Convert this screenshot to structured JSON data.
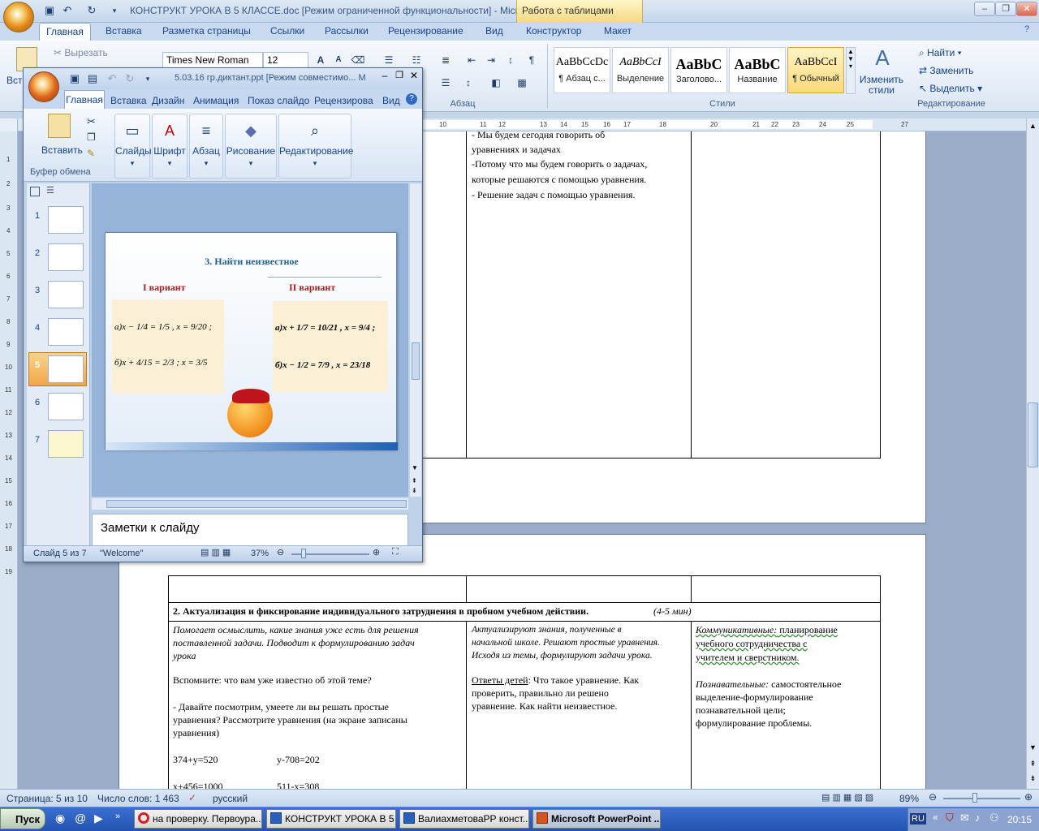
{
  "word": {
    "title": "КОНСТРУКТ УРОКА В 5 КЛАССЕ.doc [Режим ограниченной функциональности] - Micr...",
    "context_tab": "Работа с таблицами",
    "tabs": [
      "Главная",
      "Вставка",
      "Разметка страницы",
      "Ссылки",
      "Рассылки",
      "Рецензирование",
      "Вид",
      "Конструктор",
      "Макет"
    ],
    "clipboard": {
      "cut": "Вырезать",
      "insert_partial": "Вст"
    },
    "font": {
      "name": "Times New Roman",
      "size": "12"
    },
    "group_paragraph": "Абзац",
    "group_styles": "Стили",
    "group_editing": "Редактирование",
    "styles": [
      {
        "sample": "AaBbCcDc",
        "name": "¶ Абзац с..."
      },
      {
        "sample": "AaBbCcI",
        "name": "Выделение"
      },
      {
        "sample": "AaBbC",
        "name": "Заголово..."
      },
      {
        "sample": "AaBbC",
        "name": "Название"
      },
      {
        "sample": "AaBbCcI",
        "name": "¶ Обычный"
      }
    ],
    "change_styles": "Изменить стили",
    "edit_find": "Найти",
    "edit_replace": "Заменить",
    "edit_select": "Выделить",
    "ruler_nums": [
      "10",
      "11",
      "12",
      "13",
      "14",
      "15",
      "16",
      "17",
      "18",
      "20",
      "21",
      "22",
      "23",
      "24",
      "25",
      "27"
    ],
    "vruler_nums": [
      "1",
      "2",
      "3",
      "4",
      "5",
      "6",
      "7",
      "8",
      "9",
      "10",
      "11",
      "12",
      "13",
      "14",
      "15",
      "16",
      "17",
      "18",
      "19"
    ],
    "doc": {
      "top_cell_lines": [
        "- Мы будем сегодня говорить об",
        "уравнениях и задачах",
        "-Потому что мы будем говорить о задачах,",
        "которые решаются с помощью уравнения.",
        "- Решение задач с помощью уравнения."
      ],
      "section_title": "2. Актуализация и фиксирование индивидуального затруднения в пробном учебном действии.",
      "section_time": "(4-5 мин)",
      "col1_italic": [
        "Помогает осмыслить, какие знания уже есть для решения",
        "поставленной задачи. Подводит к формулированию задач",
        "урока"
      ],
      "col1_text": [
        "Вспомните: что вам уже известно об этой теме?",
        "",
        "- Давайте посмотрим, умеете ли вы решать простые",
        "уравнения? Рассмотрите уравнения (на экране записаны",
        "уравнения)"
      ],
      "col1_eq1a": "374+y=520",
      "col1_eq1b": "y-708=202",
      "col1_eq2a": "x+456=1000",
      "col1_eq2b": "511-x=308",
      "col2_italic": [
        "Актуализируют знания, полученные в",
        "начальной школе. Решают простые уравнения.",
        "Исходя из темы, формулируют задачи урока."
      ],
      "col2_label": "Ответы детей",
      "col2_text": [
        ": Что такое уравнение. Как",
        "проверить, правильно ли решено",
        "уравнение. Как найти неизвестное."
      ],
      "col3_label1": "Коммуникативные:",
      "col3_text1": [
        " планирование",
        "учебного сотрудничества с",
        "учителем и сверстником."
      ],
      "col3_label2": "Познавательные:",
      "col3_text2": [
        " самостоятельное",
        "выделение-формулирование",
        "познавательной цели;",
        "формулирование проблемы."
      ]
    },
    "status": {
      "page": "Страница: 5 из 10",
      "words": "Число слов: 1 463",
      "lang": "русский",
      "zoom": "89%"
    }
  },
  "ppt": {
    "title": "5.03.16 гр.диктант.ppt [Режим совместимо... М",
    "tabs": [
      "Главная",
      "Вставка",
      "Дизайн",
      "Анимация",
      "Показ слайдо",
      "Рецензирова",
      "Вид"
    ],
    "groups": {
      "insert": "Вставить",
      "slides": "Слайды",
      "font": "Шрифт",
      "paragraph": "Абзац",
      "drawing": "Рисование",
      "editing": "Редактирование",
      "clipboard": "Буфер обмена"
    },
    "thumbs": [
      "1",
      "2",
      "3",
      "4",
      "5",
      "6",
      "7"
    ],
    "slide": {
      "title": "3. Найти неизвестное",
      "v1": "I вариант",
      "v2": "II вариант",
      "eq_left": [
        "а)x − 1/4 = 1/5 , x = 9/20 ;",
        "б)x + 4/15 = 2/3 ; x = 3/5"
      ],
      "eq_right": [
        "а)x + 1/7 = 10/21 , x = 9/4 ;",
        "б)x − 1/2 = 7/9 , x = 23/18"
      ]
    },
    "notes": "Заметки к слайду",
    "status": {
      "slide": "Слайд 5 из 7",
      "theme": "\"Welcome\"",
      "zoom": "37%"
    }
  },
  "taskbar": {
    "start": "Пуск",
    "items": [
      "на проверку. Первоура...",
      "КОНСТРУКТ УРОКА В 5 ...",
      "ВалиахметоваРР конст...",
      "Microsoft PowerPoint ..."
    ],
    "lang": "RU",
    "time": "20:15"
  },
  "colors": {
    "accent": "#15428b",
    "slide_title": "#1f5f8f",
    "variant": "#c0141d",
    "eq_bg": "#fbefd5"
  }
}
